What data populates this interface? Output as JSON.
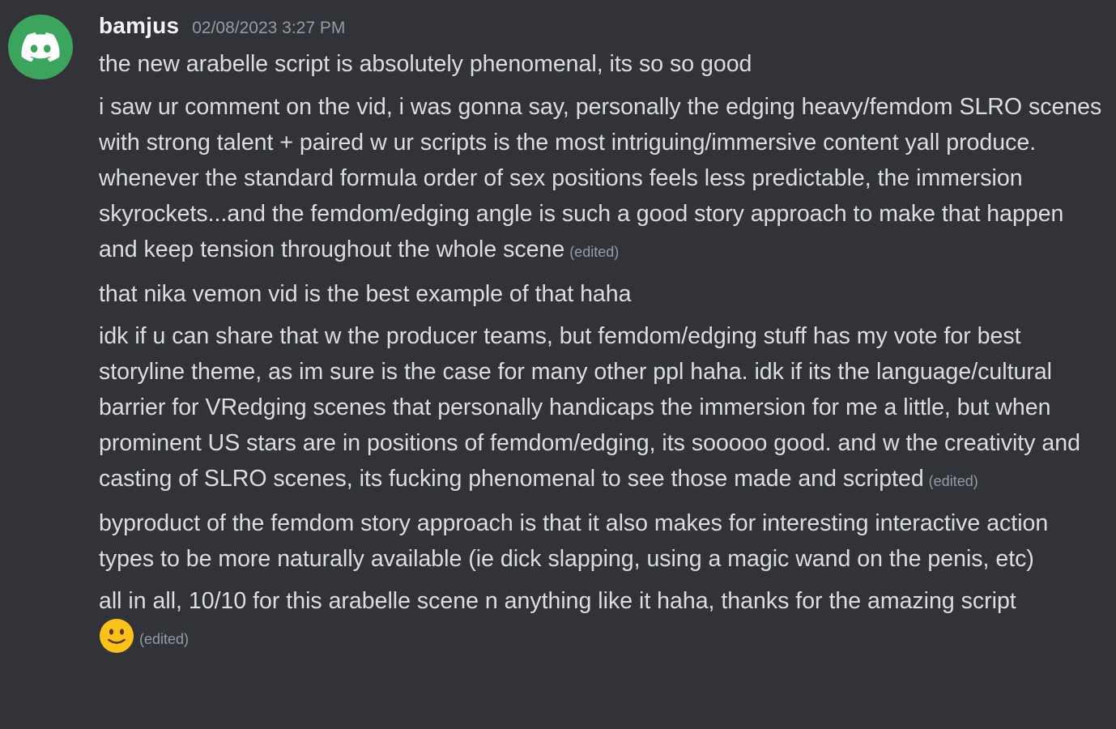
{
  "message_group": {
    "avatar_icon": "discord-logo-icon",
    "avatar_color": "#3ba55d",
    "username": "bamjus",
    "timestamp": "02/08/2023 3:27 PM",
    "messages": [
      {
        "text": "the new arabelle script is absolutely phenomenal, its so so good",
        "edited": ""
      },
      {
        "text": "i saw ur comment on the vid, i was gonna say, personally the edging heavy/femdom SLRO scenes with strong talent + paired w ur scripts is the most intriguing/immersive content yall produce. whenever the standard formula order of sex positions feels less predictable, the immersion skyrockets...and the femdom/edging angle is such a good story approach to make that happen and keep tension throughout the whole scene",
        "edited": "(edited)"
      },
      {
        "text": "that nika vemon vid is the best example of that haha",
        "edited": ""
      },
      {
        "text": "idk if u can share that w the producer teams, but femdom/edging stuff has my vote for best storyline theme, as im sure is the case for many other ppl haha. idk if its the language/cultural barrier for VRedging scenes that personally handicaps the immersion for me a little, but when prominent US stars are in positions of femdom/edging, its sooooo good. and w the creativity and casting of SLRO scenes, its fucking phenomenal to see those made and scripted",
        "edited": "(edited)"
      },
      {
        "text": "byproduct of the femdom story approach is that it also makes for interesting interactive action types to be more naturally available (ie dick slapping, using a magic wand on the penis, etc)",
        "edited": ""
      },
      {
        "text": "all in all, 10/10 for this arabelle scene n anything like it haha, thanks for the amazing script",
        "edited": "(edited)",
        "emoji": "slightly-smiling-face-emoji"
      }
    ]
  }
}
